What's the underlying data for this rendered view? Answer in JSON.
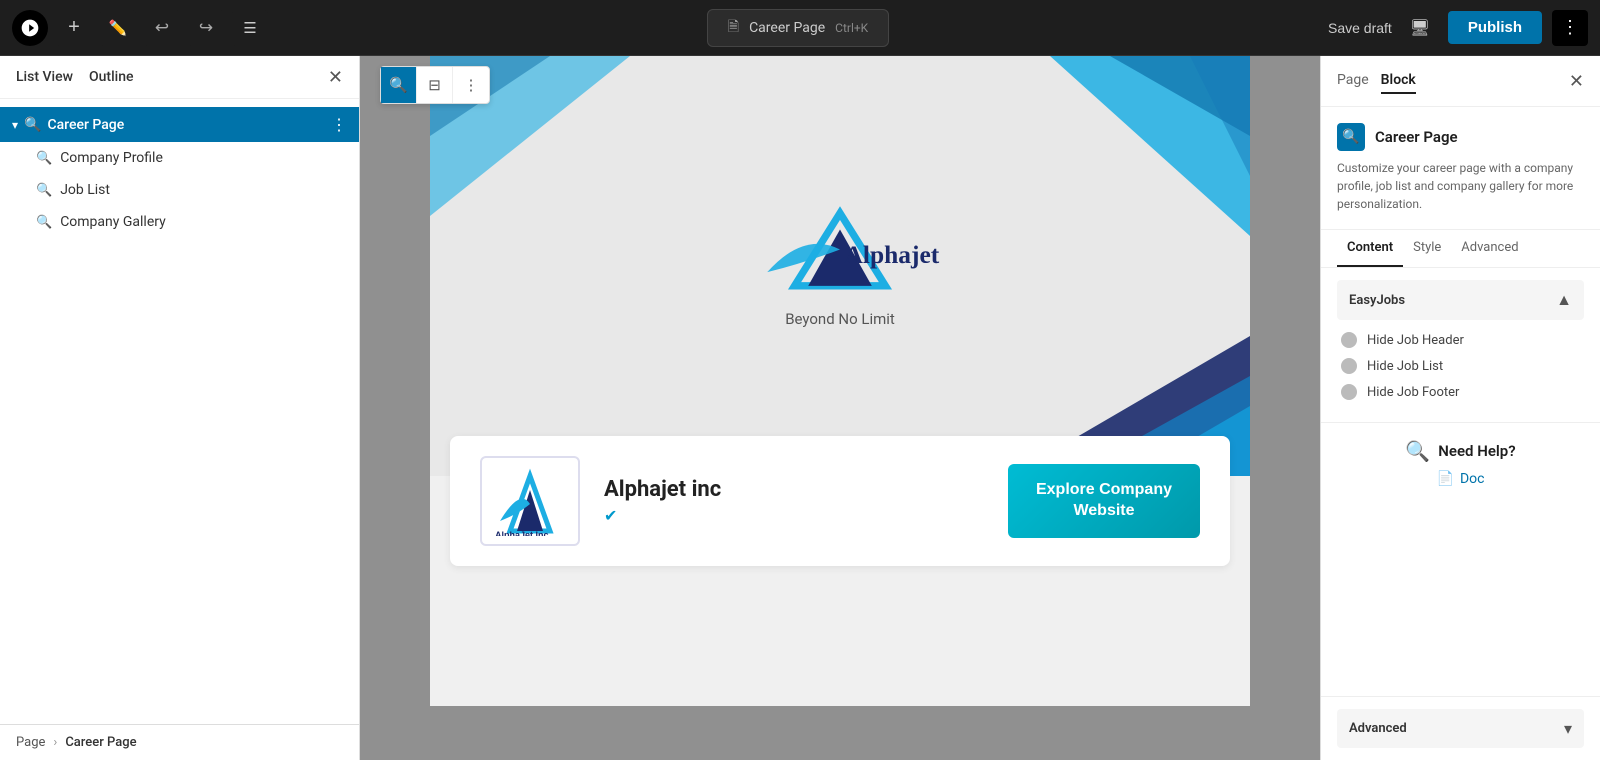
{
  "topbar": {
    "page_name": "Career Page",
    "shortcut": "Ctrl+K",
    "save_draft_label": "Save draft",
    "publish_label": "Publish"
  },
  "sidebar": {
    "list_view_label": "List View",
    "outline_label": "Outline",
    "career_page_label": "Career Page",
    "children": [
      {
        "label": "Company Profile"
      },
      {
        "label": "Job List"
      },
      {
        "label": "Company Gallery"
      }
    ]
  },
  "canvas": {
    "hero": {
      "company_name": "Alphajet Inc.",
      "tagline": "Beyond No Limit"
    },
    "profile_card": {
      "company_name": "Alphajet inc",
      "explore_btn_line1": "Explore Company",
      "explore_btn_line2": "Website"
    }
  },
  "right_panel": {
    "page_tab": "Page",
    "block_tab": "Block",
    "block_title": "Career Page",
    "block_desc": "Customize your career page with a company profile, job list and company gallery for more personalization.",
    "tabs": {
      "content": "Content",
      "style": "Style",
      "advanced": "Advanced"
    },
    "easyjobs_label": "EasyJobs",
    "toggles": [
      {
        "label": "Hide Job Header"
      },
      {
        "label": "Hide Job List"
      },
      {
        "label": "Hide Job Footer"
      }
    ],
    "need_help_title": "Need Help?",
    "doc_label": "Doc",
    "advanced_label": "Advanced"
  },
  "breadcrumb": {
    "page_label": "Page",
    "career_page_label": "Career Page"
  }
}
